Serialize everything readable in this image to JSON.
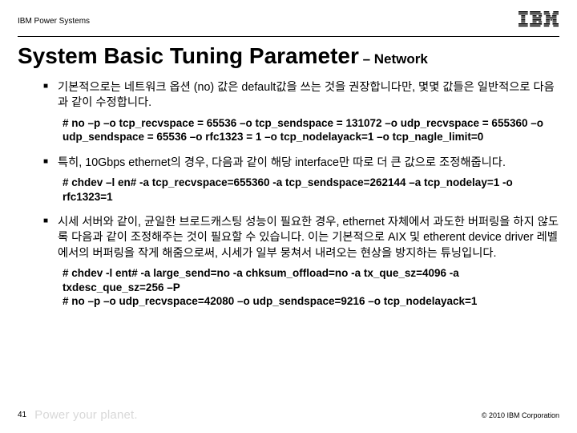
{
  "header": {
    "product_line": "IBM Power Systems",
    "logo_alt": "IBM"
  },
  "title": {
    "main": "System Basic Tuning Parameter",
    "sub": " – Network"
  },
  "bullets": [
    {
      "text": "기본적으로는 네트워크 옵션 (no) 값은 default값을 쓰는 것을 권장합니다만, 몇몇 값들은 일반적으로 다음과 같이 수정합니다.",
      "cmd": "# no –p –o tcp_recvspace = 65536 –o tcp_sendspace = 131072 –o udp_recvspace = 655360 –o udp_sendspace = 65536 –o rfc1323 = 1 –o tcp_nodelayack=1 –o tcp_nagle_limit=0"
    },
    {
      "text": "특히, 10Gbps ethernet의 경우, 다음과 같이 해당 interface만 따로 더 큰 값으로 조정해줍니다.",
      "cmd": "# chdev –l en# -a tcp_recvspace=655360 -a tcp_sendspace=262144 –a tcp_nodelay=1 -o rfc1323=1"
    },
    {
      "text": "시세 서버와 같이, 균일한 브로드캐스팅 성능이 필요한 경우, ethernet 자체에서 과도한 버퍼링을 하지 않도록 다음과 같이 조정해주는 것이 필요할 수 있습니다.  이는 기본적으로 AIX 및 etherent device driver 레벨에서의 버퍼링을 작게 해줌으로써, 시세가 일부 뭉쳐서 내려오는 현상을 방지하는 튜닝입니다.",
      "cmd": "# chdev  -l ent# -a large_send=no -a chksum_offload=no -a tx_que_sz=4096 -a txdesc_que_sz=256 –P\n#  no –p  –o  udp_recvspace=42080 –o udp_sendspace=9216 –o tcp_nodelayack=1"
    }
  ],
  "footer": {
    "page_number": "41",
    "tagline": "Power your planet.",
    "copyright": "© 2010 IBM Corporation"
  }
}
